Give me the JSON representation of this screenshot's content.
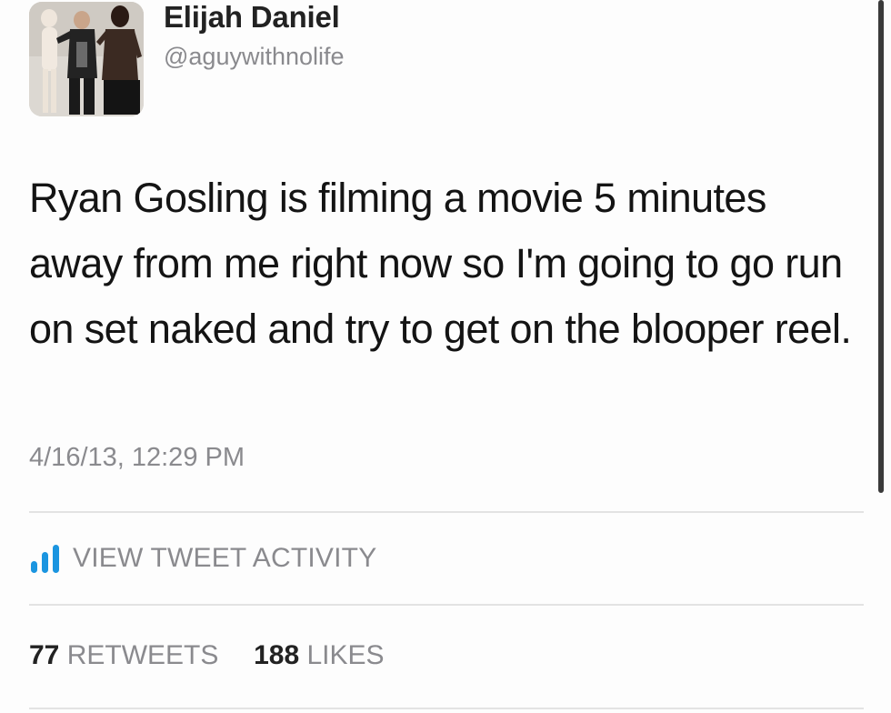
{
  "tweet": {
    "author": {
      "display_name": "Elijah Daniel",
      "handle": "@aguywithnolife",
      "avatar_icon": "profile-photo"
    },
    "text": "Ryan Gosling is filming a movie 5 minutes away from me right now so I'm going to go run on set naked and try to get on the blooper reel.",
    "timestamp": "4/16/13, 12:29 PM",
    "activity": {
      "icon": "bar-chart-icon",
      "label": "VIEW TWEET ACTIVITY"
    },
    "stats": {
      "retweets_count": "77",
      "retweets_label": "RETWEETS",
      "likes_count": "188",
      "likes_label": "LIKES"
    }
  },
  "colors": {
    "primary_text": "#141414",
    "secondary_text": "#8a8a8e",
    "accent": "#1b95e0",
    "divider": "#e3e3e3"
  }
}
